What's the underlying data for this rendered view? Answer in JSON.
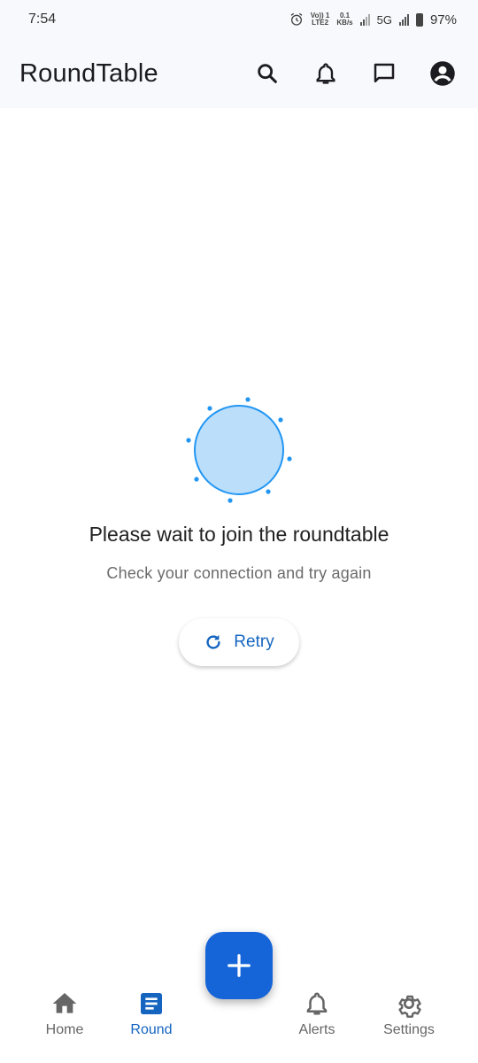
{
  "status_bar": {
    "time": "7:54",
    "volte": "Vo)) 1",
    "lte": "LTE2",
    "speed": "0.1",
    "speed_unit": "KB/s",
    "network": "5G",
    "battery": "97%"
  },
  "app_bar": {
    "title": "RoundTable"
  },
  "empty_state": {
    "title": "Please wait to join the roundtable",
    "subtitle": "Check your connection and try again",
    "retry_label": "Retry"
  },
  "bottom_nav": {
    "items": [
      {
        "label": "Home",
        "icon": "home-icon"
      },
      {
        "label": "Round",
        "icon": "article-icon",
        "active": true
      },
      {
        "label": "Alerts",
        "icon": "bell-icon"
      },
      {
        "label": "Settings",
        "icon": "gear-icon"
      }
    ]
  },
  "colors": {
    "accent": "#1565c0",
    "fab": "#1565d8",
    "illustration_fill": "#bbdefb",
    "illustration_stroke": "#2196f3"
  }
}
